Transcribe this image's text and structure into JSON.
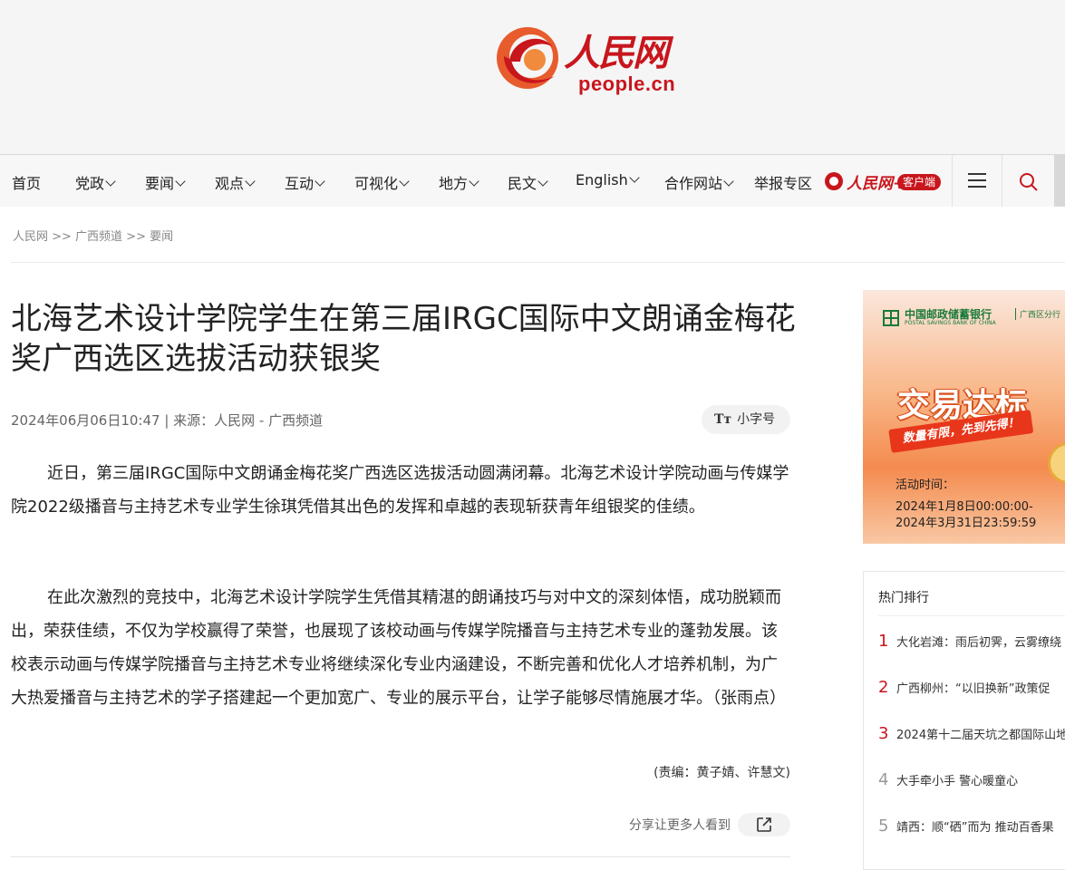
{
  "header": {
    "logo_wordmark": "人民网",
    "logo_domain": "people.cn",
    "brand_color": "#c8161d"
  },
  "nav": {
    "items": [
      {
        "label": "首页",
        "dropdown": false
      },
      {
        "label": "党政",
        "dropdown": true
      },
      {
        "label": "要闻",
        "dropdown": true
      },
      {
        "label": "观点",
        "dropdown": true
      },
      {
        "label": "互动",
        "dropdown": true
      },
      {
        "label": "可视化",
        "dropdown": true
      },
      {
        "label": "地方",
        "dropdown": true
      },
      {
        "label": "民文",
        "dropdown": true
      },
      {
        "label": "English",
        "dropdown": true
      },
      {
        "label": "合作网站",
        "dropdown": true
      },
      {
        "label": "举报专区",
        "dropdown": false
      }
    ],
    "app_brand": "人民网+",
    "app_badge": "客户端",
    "menu_icon": "hamburger-menu-icon",
    "search_icon": "search-icon"
  },
  "breadcrumb": "人民网 >> 广西频道 >> 要闻",
  "article": {
    "title": "北海艺术设计学院学生在第三届IRGC国际中文朗诵金梅花奖广西选区选拔活动获银奖",
    "meta": "2024年06月06日10:47 | 来源：人民网 - 广西频道",
    "font_toggle_glyph": "Tт",
    "font_toggle_label": "小字号",
    "paragraphs": [
      "近日，第三届IRGC国际中文朗诵金梅花奖广西选区选拔活动圆满闭幕。北海艺术设计学院动画与传媒学院2022级播音与主持艺术专业学生徐琪凭借其出色的发挥和卓越的表现斩获青年组银奖的佳绩。",
      "在此次激烈的竞技中，北海艺术设计学院学生凭借其精湛的朗诵技巧与对中文的深刻体悟，成功脱颖而出，荣获佳绩，不仅为学校赢得了荣誉，也展现了该校动画与传媒学院播音与主持艺术专业的蓬勃发展。该校表示动画与传媒学院播音与主持艺术专业将继续深化专业内涵建设，不断完善和优化人才培养机制，为广大热爱播音与主持艺术的学子搭建起一个更加宽广、专业的展示平台，让学子能够尽情施展才华。（张雨点）"
    ],
    "editor": "(责编：黄子婧、许慧文)",
    "share_label": "分享让更多人看到",
    "share_icon": "share-external-icon"
  },
  "sidebar": {
    "ad": {
      "bank_name": "中国邮政储蓄银行",
      "bank_name_en": "POSTAL SAVINGS BANK OF CHINA",
      "branch": "广西区分行",
      "headline": "交易达标",
      "ribbon": "数量有限，先到先得！",
      "time_label": "活动时间：",
      "time_start": "2024年1月8日00:00:00-",
      "time_end": "2024年3月31日23:59:59"
    },
    "hot": {
      "title": "热门排行",
      "items": [
        {
          "rank": "1",
          "text": "大化岩滩：雨后初霁，云雾缭绕"
        },
        {
          "rank": "2",
          "text": "广西柳州：“以旧换新”政策促"
        },
        {
          "rank": "3",
          "text": "2024第十二届天坑之都国际山地"
        },
        {
          "rank": "4",
          "text": "大手牵小手 警心暖童心"
        },
        {
          "rank": "5",
          "text": "靖西：顺“硒”而为 推动百香果"
        }
      ],
      "rank_colors": [
        "#c8161d",
        "#c8161d",
        "#c8161d",
        "#999999",
        "#999999"
      ]
    }
  }
}
